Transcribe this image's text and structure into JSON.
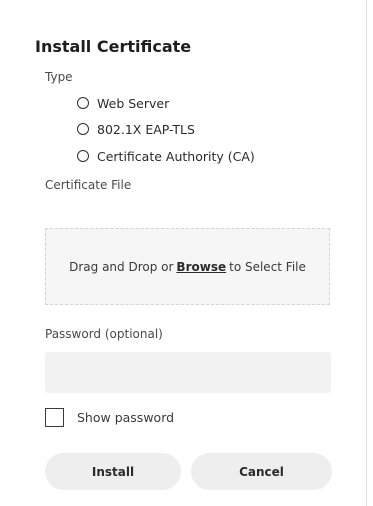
{
  "dialog": {
    "title": "Install Certificate"
  },
  "type_section": {
    "label": "Type",
    "options": [
      {
        "label": "Web Server",
        "selected": false
      },
      {
        "label": "802.1X EAP-TLS",
        "selected": false
      },
      {
        "label": "Certificate Authority (CA)",
        "selected": false
      }
    ]
  },
  "file_section": {
    "label": "Certificate File",
    "dropzone_prefix": "Drag and Drop or",
    "browse_label": "Browse",
    "dropzone_suffix": "to Select File"
  },
  "password_section": {
    "label": "Password (optional)",
    "value": "",
    "show_password_label": "Show password",
    "show_password_checked": false
  },
  "actions": {
    "install_label": "Install",
    "cancel_label": "Cancel"
  }
}
